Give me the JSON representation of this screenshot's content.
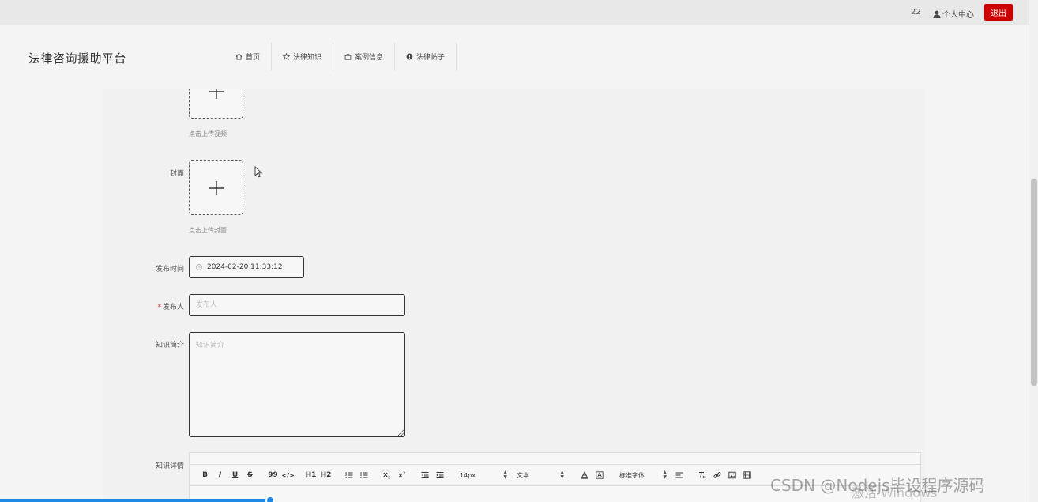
{
  "topbar": {
    "count": "22",
    "user_center": "个人中心",
    "logout": "退出"
  },
  "header": {
    "site_title": "法律咨询援助平台",
    "nav": [
      {
        "label": "首页",
        "icon": "home-icon"
      },
      {
        "label": "法律知识",
        "icon": "star-icon"
      },
      {
        "label": "案例信息",
        "icon": "bag-icon"
      },
      {
        "label": "法律帖子",
        "icon": "alert-circle-icon"
      }
    ]
  },
  "form": {
    "video_hint": "点击上传视频",
    "cover_label": "封面",
    "cover_hint": "点击上传封面",
    "publish_time_label": "发布时间",
    "publish_time_value": "2024-02-20 11:33:12",
    "publisher_label": "发布人",
    "publisher_placeholder": "发布人",
    "intro_label": "知识简介",
    "intro_placeholder": "知识简介",
    "detail_label": "知识详情"
  },
  "editor_toolbar": {
    "buttons": [
      "B",
      "I",
      "U",
      "S",
      "99",
      "</>",
      "H1",
      "H2"
    ],
    "size_select": "14px",
    "type_select": "文本",
    "font_select": "标准字体"
  },
  "overlay": {
    "watermark": "CSDN @Nodejs毕设程序源码",
    "activate": "激活 Windows"
  }
}
